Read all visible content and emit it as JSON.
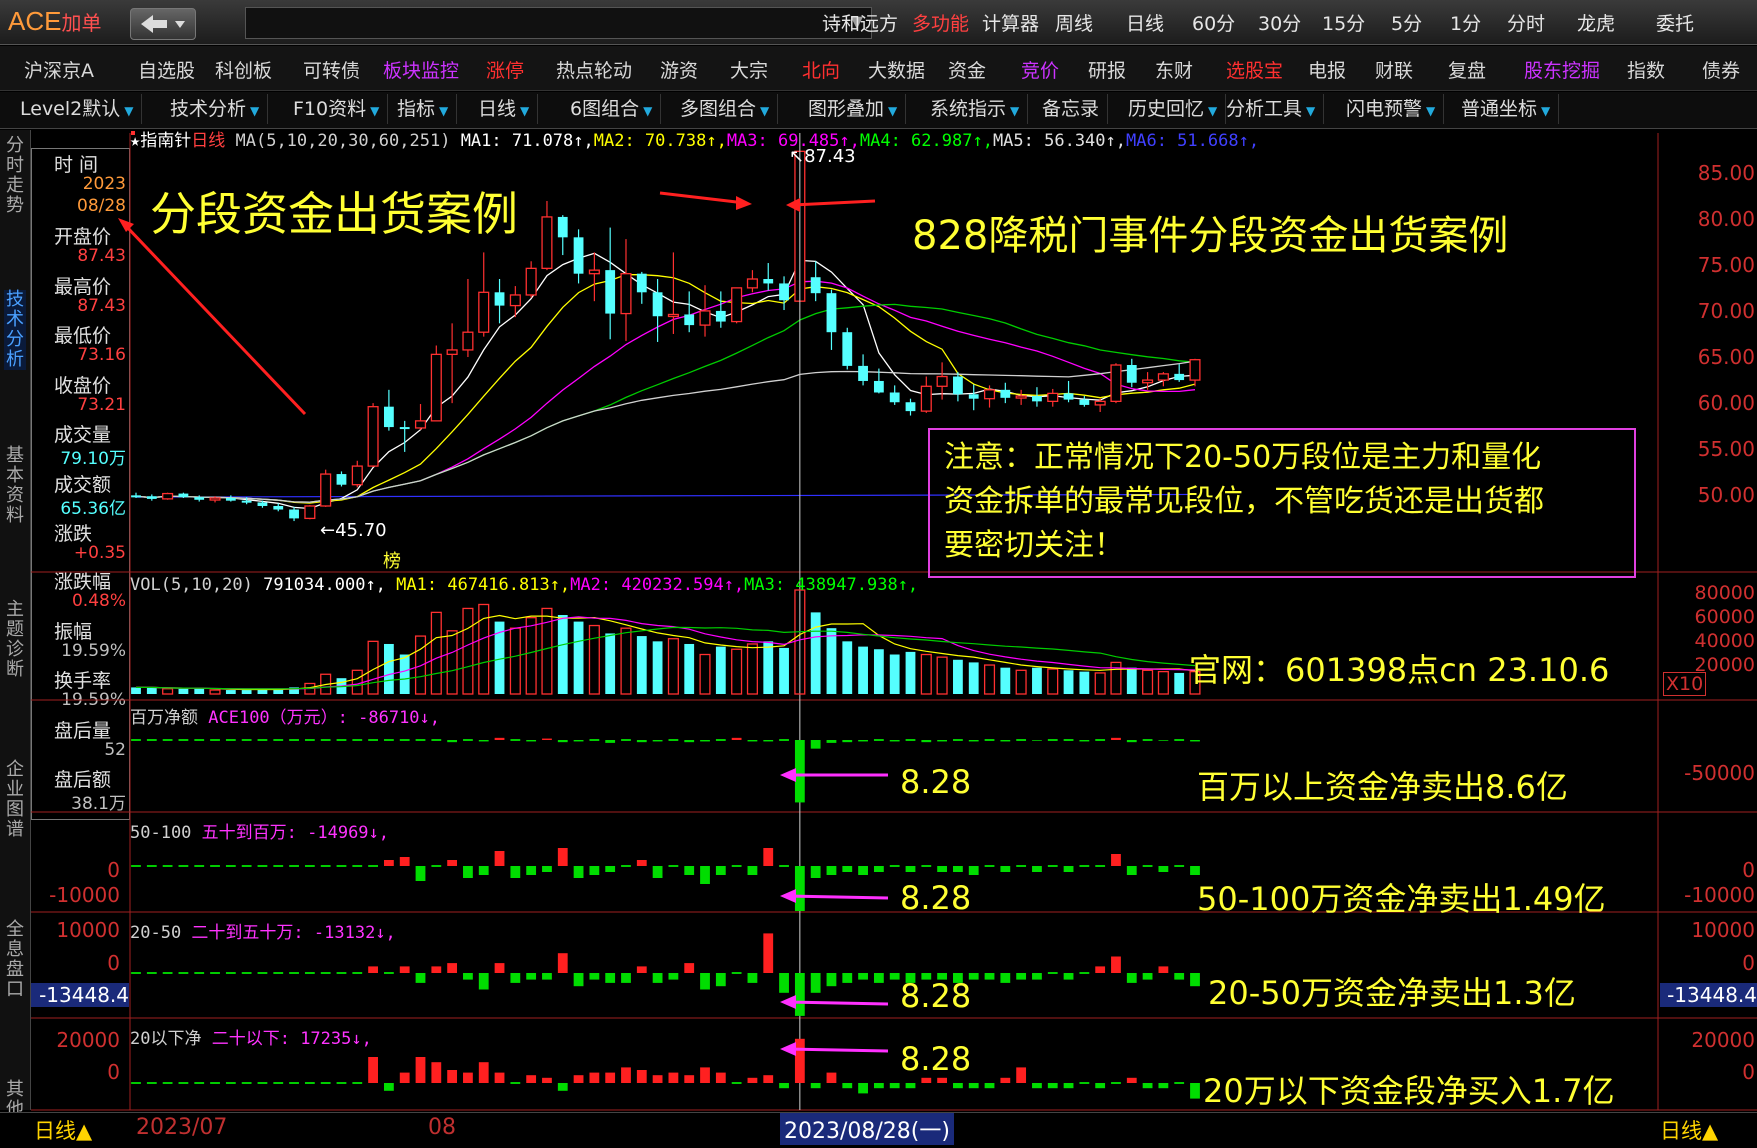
{
  "top": {
    "logo": "ACE",
    "logo_sub": "加单",
    "menu": [
      "诗和远方",
      "多功能",
      "计算器",
      "周线",
      "日线",
      "60分",
      "30分",
      "15分",
      "5分",
      "1分",
      "分时",
      "龙虎",
      "委托"
    ],
    "menu_active": "多功能"
  },
  "row2": {
    "items": [
      "沪深京A",
      "自选股",
      "科创板",
      "可转债",
      "板块监控",
      "涨停",
      "热点轮动",
      "游资",
      "大宗",
      "北向",
      "大数据",
      "资金",
      "竞价",
      "研报",
      "东财",
      "选股宝",
      "电报",
      "财联",
      "复盘",
      "股东挖掘",
      "指数",
      "债券"
    ],
    "highlight_red": [
      "涨停",
      "北向",
      "选股宝"
    ],
    "highlight_purple": [
      "板块监控",
      "竞价",
      "股东挖掘"
    ]
  },
  "row3": {
    "items": [
      "Level2默认",
      "技术分析",
      "F10资料",
      "指标",
      "日线",
      "6图组合",
      "多图组合",
      "图形叠加",
      "系统指示",
      "备忘录",
      "历史回忆",
      "分析工具",
      "闪电预警",
      "普通坐标"
    ]
  },
  "left_tabs": [
    "分时走势",
    "技术分析",
    "基本资料",
    "主题诊断",
    "企业图谱",
    "全息盘口",
    "其他"
  ],
  "info": {
    "labels": [
      "时间",
      "开盘价",
      "最高价",
      "最低价",
      "收盘价",
      "成交量",
      "成交额",
      "涨跌",
      "涨跌幅",
      "振幅",
      "换手率",
      "盘后量",
      "盘后额"
    ],
    "date_year": "2023",
    "date_md": "08/28",
    "values": {
      "open": "87.43",
      "high": "87.43",
      "low": "73.16",
      "close": "73.21",
      "volume": "79.10万",
      "amount": "65.36亿",
      "change": "+0.35",
      "change_pct": "0.48%",
      "amplitude": "19.59%",
      "turnover": "19.59%",
      "after_vol": "52",
      "after_amt": "38.1万"
    }
  },
  "main_chart": {
    "stock_name": "指南针",
    "period": "日线",
    "ma_header": "MA(5,10,20,30,60,251)",
    "ma": [
      {
        "label": "MA1: 71.078",
        "color": "#ffffff"
      },
      {
        "label": "MA2: 70.738",
        "color": "#ffff00"
      },
      {
        "label": "MA3: 69.485",
        "color": "#ff00ff"
      },
      {
        "label": "MA4: 62.987",
        "color": "#00ff00"
      },
      {
        "label": "MA5: 56.340",
        "color": "#e0e0e0"
      },
      {
        "label": "MA6: 51.668",
        "color": "#4040ff"
      }
    ],
    "high_mark": "87.43",
    "low_mark": "45.70",
    "bang_mark": "榜",
    "y_ticks": [
      "85.00",
      "80.00",
      "75.00",
      "70.00",
      "65.00",
      "60.00",
      "55.00",
      "50.00"
    ],
    "title_left": "分段资金出货案例",
    "title_right": "828降税门事件分段资金出货案例",
    "note": [
      "注意：正常情况下20-50万段位是主力和量化",
      "资金拆单的最常见段位，不管吃货还是出货都",
      "要密切关注！"
    ]
  },
  "vol_chart": {
    "header": "VOL(5,10,20)",
    "value": "791034.000",
    "ma": [
      {
        "label": "MA1: 467416.813",
        "color": "#ffff00"
      },
      {
        "label": "MA2: 420232.594",
        "color": "#ff00ff"
      },
      {
        "label": "MA3: 438947.938",
        "color": "#00ff00"
      }
    ],
    "y_ticks": [
      "80000",
      "60000",
      "40000",
      "20000"
    ],
    "unit": "X10",
    "watermark": "官网：601398点cn 23.10.6"
  },
  "fund_panels": [
    {
      "header": "百万净额",
      "name": "ACE100（万元）: -86710",
      "y_left": [],
      "y_right": [
        "-50000"
      ],
      "date": "8.28",
      "caption": "百万以上资金净卖出8.6亿"
    },
    {
      "header": "50-100",
      "name": "五十到百万: -14969",
      "y_left": [
        "0",
        "-10000"
      ],
      "y_right": [
        "0",
        "-10000"
      ],
      "date": "8.28",
      "caption": "50-100万资金净卖出1.49亿"
    },
    {
      "header": "20-50",
      "name": "二十到五十万: -13132",
      "y_left": [
        "10000",
        "0"
      ],
      "y_right": [
        "10000",
        "0"
      ],
      "cursor_value": "-13448.4",
      "date": "8.28",
      "caption": "20-50万资金净卖出1.3亿"
    },
    {
      "header": "20以下净",
      "name": "二十以下: 17235",
      "y_left": [
        "20000",
        "0"
      ],
      "y_right": [
        "20000",
        "0"
      ],
      "date": "8.28",
      "caption": "20万以下资金段净买入1.7亿"
    }
  ],
  "bottom": {
    "period_label": "日线▲",
    "date_left": "2023/07",
    "date_mid": "08",
    "cursor_date": "2023/08/28(一)",
    "period_label_right": "日线▲"
  },
  "colors": {
    "up": "#ff3030",
    "down": "#55ffff",
    "green": "#00ee00",
    "accent": "#ff9a3a"
  },
  "chart_data": {
    "type": "candlestick",
    "title": "828降税门事件分段资金出货案例",
    "ylim": [
      43,
      88
    ],
    "candles": [
      [
        48.6,
        48.9,
        48.3,
        48.5
      ],
      [
        48.5,
        48.7,
        48.0,
        48.2
      ],
      [
        48.2,
        48.9,
        48.1,
        48.8
      ],
      [
        48.8,
        48.9,
        48.3,
        48.4
      ],
      [
        48.4,
        48.6,
        47.9,
        48.1
      ],
      [
        48.1,
        48.5,
        47.8,
        48.3
      ],
      [
        48.3,
        48.6,
        47.9,
        48.0
      ],
      [
        48.0,
        48.4,
        47.6,
        47.8
      ],
      [
        47.8,
        48.0,
        47.2,
        47.4
      ],
      [
        47.4,
        47.7,
        46.8,
        47.0
      ],
      [
        47.0,
        47.3,
        45.7,
        46.0
      ],
      [
        46.0,
        47.5,
        45.9,
        47.4
      ],
      [
        47.4,
        51.5,
        47.3,
        51.0
      ],
      [
        51.0,
        51.3,
        49.6,
        49.8
      ],
      [
        49.8,
        52.5,
        49.5,
        51.9
      ],
      [
        51.9,
        59.0,
        51.8,
        58.6
      ],
      [
        58.6,
        60.5,
        55.9,
        56.3
      ],
      [
        56.3,
        57.0,
        53.5,
        56.2
      ],
      [
        56.2,
        58.9,
        56.0,
        57.0
      ],
      [
        57.0,
        65.5,
        57.0,
        64.5
      ],
      [
        64.5,
        68.0,
        59.0,
        65.0
      ],
      [
        65.0,
        73.0,
        64.2,
        67.0
      ],
      [
        67.0,
        76.0,
        66.5,
        71.5
      ],
      [
        71.5,
        73.0,
        68.0,
        70.0
      ],
      [
        70.0,
        72.2,
        68.7,
        71.2
      ],
      [
        71.2,
        75.0,
        70.9,
        74.2
      ],
      [
        74.2,
        81.8,
        74.0,
        80.0
      ],
      [
        80.0,
        80.2,
        75.7,
        77.7
      ],
      [
        77.7,
        78.6,
        72.5,
        73.6
      ],
      [
        73.6,
        76.0,
        70.5,
        74.0
      ],
      [
        74.0,
        78.8,
        66.2,
        69.1
      ],
      [
        69.1,
        77.5,
        66.0,
        73.6
      ],
      [
        73.6,
        73.8,
        70.2,
        71.5
      ],
      [
        71.5,
        73.0,
        65.9,
        68.8
      ],
      [
        68.8,
        76.0,
        66.8,
        69.0
      ],
      [
        69.0,
        71.6,
        67.0,
        67.8
      ],
      [
        67.8,
        72.3,
        66.5,
        69.4
      ],
      [
        69.4,
        71.6,
        67.5,
        68.2
      ],
      [
        68.2,
        72.0,
        68.0,
        72.0
      ],
      [
        72.0,
        74.0,
        71.5,
        73.0
      ],
      [
        73.0,
        74.8,
        71.7,
        72.5
      ],
      [
        72.5,
        73.3,
        69.5,
        70.6
      ],
      [
        70.5,
        87.4,
        73.2,
        87.4
      ],
      [
        73.2,
        75.0,
        70.5,
        71.4
      ],
      [
        71.4,
        71.8,
        65.0,
        67.0
      ],
      [
        67.0,
        67.5,
        62.8,
        63.2
      ],
      [
        63.2,
        64.5,
        61.0,
        61.5
      ],
      [
        61.5,
        62.9,
        60.1,
        60.2
      ],
      [
        60.2,
        61.0,
        58.8,
        59.1
      ],
      [
        59.1,
        59.5,
        57.6,
        58.1
      ],
      [
        58.1,
        62.0,
        57.9,
        60.9
      ],
      [
        60.9,
        63.6,
        59.4,
        62.0
      ],
      [
        62.0,
        62.5,
        59.2,
        60.0
      ],
      [
        60.0,
        61.1,
        58.2,
        59.5
      ],
      [
        59.5,
        61.0,
        58.5,
        60.5
      ],
      [
        60.5,
        61.3,
        59.0,
        59.6
      ],
      [
        59.6,
        60.5,
        58.8,
        59.8
      ],
      [
        59.8,
        60.8,
        58.6,
        59.2
      ],
      [
        59.2,
        60.6,
        58.6,
        60.1
      ],
      [
        60.1,
        61.5,
        59.1,
        59.4
      ],
      [
        59.4,
        59.8,
        58.6,
        58.8
      ],
      [
        58.8,
        59.5,
        58.0,
        59.2
      ],
      [
        59.2,
        63.5,
        59.0,
        63.3
      ],
      [
        63.3,
        64.0,
        60.8,
        61.3
      ],
      [
        61.3,
        62.5,
        60.5,
        61.6
      ],
      [
        61.6,
        62.5,
        60.9,
        62.3
      ],
      [
        62.3,
        63.4,
        61.4,
        61.6
      ],
      [
        61.6,
        64.0,
        60.9,
        63.9
      ]
    ],
    "volume": [
      5,
      5,
      4,
      4,
      4,
      3,
      3,
      3,
      4,
      4,
      5,
      8,
      15,
      12,
      18,
      40,
      38,
      30,
      44,
      62,
      48,
      65,
      68,
      55,
      50,
      58,
      65,
      60,
      55,
      52,
      46,
      50,
      44,
      40,
      42,
      38,
      30,
      36,
      34,
      38,
      40,
      35,
      79,
      62,
      50,
      40,
      36,
      34,
      30,
      32,
      30,
      28,
      26,
      24,
      22,
      20,
      18,
      20,
      19,
      18,
      17,
      16,
      24,
      20,
      18,
      17,
      16,
      17
    ],
    "fund_million": [
      0,
      0,
      0,
      0,
      0,
      0,
      0,
      0,
      0,
      0,
      0,
      0,
      0,
      0,
      0,
      0,
      0,
      0,
      0,
      0,
      -3,
      0,
      -2,
      3,
      0,
      -2,
      2,
      -3,
      -2,
      0,
      -4,
      0,
      -3,
      -2,
      0,
      -3,
      -2,
      0,
      3,
      -2,
      -2,
      0,
      -86.7,
      -12,
      -4,
      -3,
      -2,
      0,
      -2,
      0,
      -3,
      -2,
      0,
      -2,
      0,
      -2,
      0,
      -1,
      0,
      0,
      -2,
      0,
      3,
      -3,
      0,
      -1,
      0,
      -2
    ],
    "fund_50_100": [
      0,
      0,
      0,
      0,
      0,
      0,
      0,
      0,
      0,
      0,
      0,
      0,
      0,
      0,
      0,
      0,
      2,
      3,
      -5,
      0,
      2,
      -4,
      -3,
      5,
      -4,
      -3,
      -2,
      6,
      -4,
      -3,
      -2,
      0,
      2,
      -4,
      0,
      -3,
      -6,
      -3,
      0,
      -3,
      6,
      0,
      -15,
      -4,
      -3,
      -2,
      -3,
      -2,
      0,
      -2,
      0,
      -2,
      -2,
      -3,
      0,
      -2,
      0,
      -2,
      0,
      -2,
      0,
      0,
      4,
      -3,
      0,
      -2,
      0,
      -3
    ],
    "fund_20_50": [
      0,
      0,
      0,
      0,
      0,
      0,
      0,
      0,
      0,
      0,
      0,
      0,
      0,
      0,
      0,
      2,
      0,
      2,
      -3,
      2,
      3,
      -2,
      -5,
      3,
      -3,
      -2,
      -2,
      6,
      -4,
      -2,
      -3,
      -3,
      2,
      -3,
      -2,
      3,
      -5,
      -4,
      0,
      -3,
      12,
      -6,
      -13,
      -6,
      -4,
      -3,
      -2,
      -3,
      -2,
      -3,
      -2,
      -2,
      -3,
      -2,
      -2,
      -3,
      -2,
      -2,
      0,
      -2,
      0,
      2,
      5,
      -3,
      -2,
      2,
      -2,
      -4
    ],
    "fund_below_20": [
      0,
      0,
      0,
      0,
      0,
      0,
      0,
      0,
      0,
      0,
      0,
      0,
      0,
      0,
      0,
      10,
      -3,
      4,
      10,
      8,
      5,
      4,
      8,
      4,
      0,
      3,
      2,
      -3,
      3,
      4,
      4,
      6,
      5,
      3,
      4,
      3,
      6,
      4,
      0,
      2,
      3,
      -2,
      17,
      -2,
      4,
      -2,
      -4,
      -2,
      -2,
      -2,
      2,
      2,
      -2,
      -2,
      -2,
      2,
      6,
      -2,
      -2,
      -2,
      0,
      -2,
      0,
      2,
      -2,
      -2,
      0,
      -6
    ]
  }
}
